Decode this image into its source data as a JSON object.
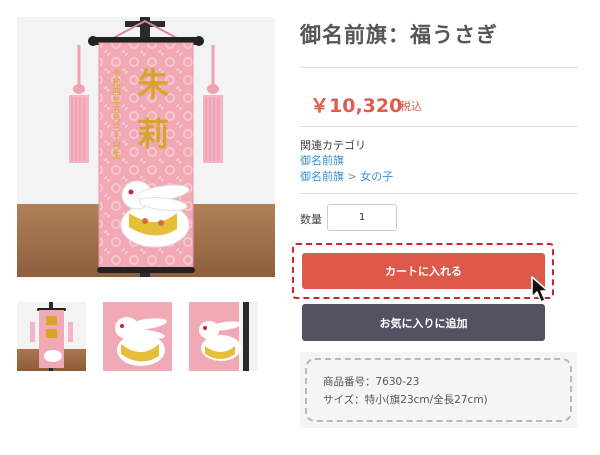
{
  "product": {
    "title": "御名前旗：福うさぎ",
    "price": "￥10,320",
    "tax_label": "税込",
    "category_heading": "関連カテゴリ",
    "category_link": "御名前旗",
    "category_path": {
      "parent": "御名前旗",
      "separator": " > ",
      "child": "女の子"
    },
    "quantity_label": "数量",
    "quantity_value": "1",
    "add_to_cart_label": "カートに入れる",
    "add_to_favorites_label": "お気に入りに追加",
    "details": {
      "product_code": "商品番号：7630-23",
      "size": "サイズ：特小(旗23cm/全長27cm)"
    }
  },
  "banner": {
    "name_embroidery": [
      "朱",
      "莉"
    ],
    "side_embroidery": "令和四年五月三十日生"
  },
  "colors": {
    "price": "#dd5e4f",
    "cart_button": "#dd5a4a",
    "favorite_button": "#525263",
    "link": "#3a8fd1",
    "banner_pink": "#f2a9b6",
    "gold_embroidery": "#d6a62c"
  },
  "icons": [
    "tassel-icon",
    "rabbit-icon",
    "mouse-cursor-icon"
  ]
}
